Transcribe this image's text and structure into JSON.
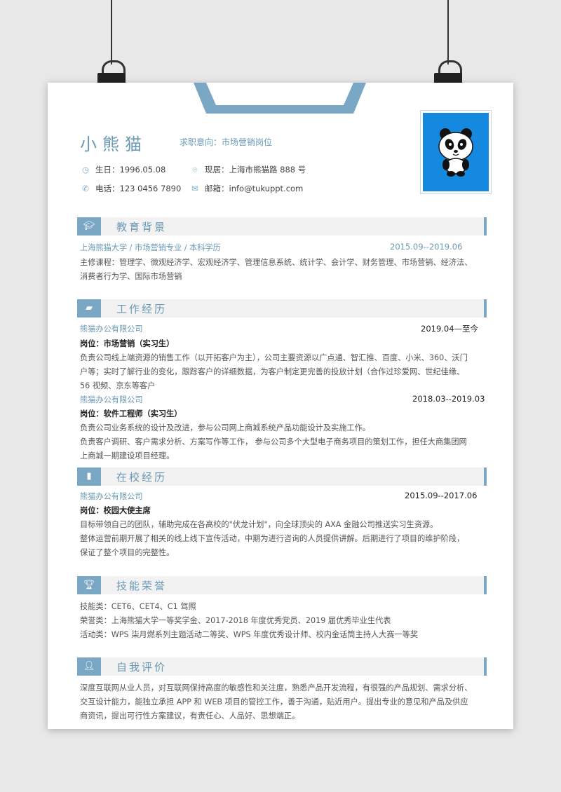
{
  "header": {
    "name": "小熊猫",
    "intent": "求职意向：市场营销岗位",
    "birthday": "生日：1996.05.08",
    "residence": "现居：上海市熊猫路 888 号",
    "phone": "电话：123 0456 7890",
    "email": "邮箱：info@tukuppt.com"
  },
  "sections": {
    "education": {
      "title": "教育背景",
      "school_line": "上海熊猫大学   /   市场营销专业   /   本科学历",
      "date": "2015.09--2019.06",
      "courses_1": "主修课程：管理学、微观经济学、宏观经济学、管理信息系统、统计学、会计学、财务管理、市场营销、经济法、",
      "courses_2": "消费者行为学、国际市场营销"
    },
    "work": {
      "title": "工作经历",
      "job1": {
        "company": "熊猫办公有限公司",
        "date": "2019.04—至今",
        "role": "岗位：市场营销（实习生）",
        "desc_1": "负责公司线上端资源的销售工作（以开拓客户为主），公司主要资源以广点通、智汇推、百度、小米、360、沃门",
        "desc_2": "户等；实时了解行业的变化，跟踪客户的详细数据，为客户制定更完善的投放计划（合作过珍爱网、世纪佳缘、",
        "desc_3": "56 视频、京东等客户"
      },
      "job2": {
        "company": "熊猫办公有限公司",
        "date": "2018.03--2019.03",
        "role": "岗位：软件工程师（实习生）",
        "desc_1": "负责公司业务系统的设计及改进，参与公司网上商城系统产品功能设计及实施工作。",
        "desc_2": "负责客户调研、客户需求分析、方案写作等工作，  参与公司多个大型电子商务项目的策划工作，担任大商集团网",
        "desc_3": "上商城一期建设项目经理。"
      }
    },
    "campus": {
      "title": "在校经历",
      "company": "熊猫办公有限公司",
      "date": "2015.09--2017.06",
      "role": "岗位：校园大使主席",
      "desc_1": "目标带领自己的团队，辅助完成在各高校的\"伏龙计划\"，向全球顶尖的 AXA 金融公司推送实习生资源。",
      "desc_2": "整体运营前期开展了相关的线上线下宣传活动，中期为进行咨询的人员提供讲解。后期进行了项目的维护阶段，",
      "desc_3": "保证了整个项目的完整性。"
    },
    "skills": {
      "title": "技能荣誉",
      "line_1": "技能类：CET6、CET4、C1 驾照",
      "line_2": "荣誉类：上海熊猫大学一等奖学金、2017-2018 年度优秀党员、2019 届优秀毕业生代表",
      "line_3": "活动类：WPS 柒月燃系列主题活动二等奖、WPS 年度优秀设计师、校内金话筒主持人大赛一等奖"
    },
    "self": {
      "title": "自我评价",
      "line_1": "深度互联网从业人员，对互联网保持高度的敏感性和关注度，熟悉产品开发流程，有很强的产品规划、需求分析、",
      "line_2": "交互设计能力，能独立承担 APP 和 WEB 项目的管控工作，善于沟通，贴近用户。提出专业的意见和产品及供应",
      "line_3": "商资讯，提出可行性方案建议，有责任心、人品好、思想端正。"
    }
  },
  "colors": {
    "accent": "#7aa7c4",
    "accent_text": "#6a99b4",
    "photo_bg": "#1588e0"
  },
  "icons": [
    "clock-icon",
    "location-icon",
    "phone-icon",
    "mail-icon",
    "graduation-cap-icon",
    "briefcase-icon",
    "book-icon",
    "trophy-icon",
    "person-icon"
  ]
}
